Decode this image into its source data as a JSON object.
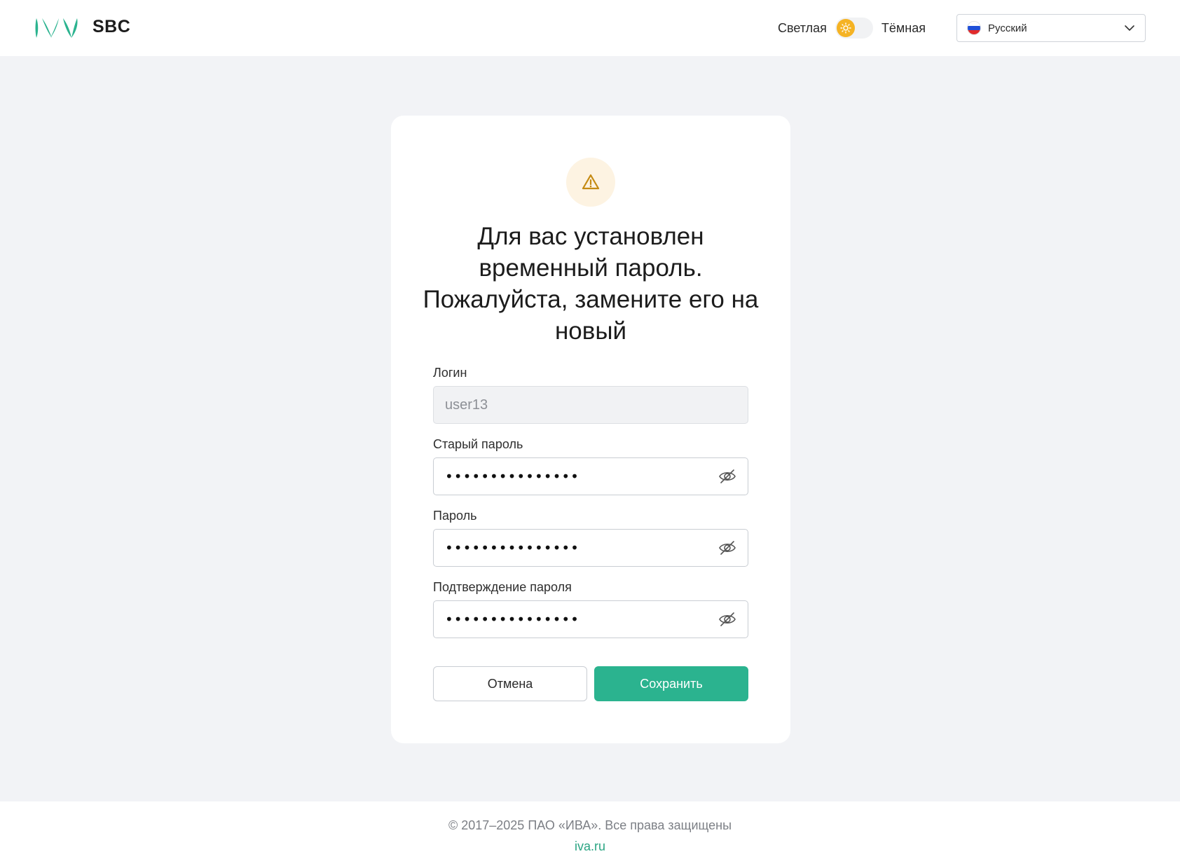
{
  "header": {
    "app_name": "SBC",
    "theme": {
      "light_label": "Светлая",
      "dark_label": "Тёмная",
      "current": "light"
    },
    "language": {
      "selected": "Русский",
      "flag": "ru-flag-icon"
    }
  },
  "card": {
    "icon": "warning-icon",
    "title": "Для вас установлен временный пароль. Пожалуйста, замените его на новый",
    "fields": {
      "login": {
        "label": "Логин",
        "value": "user13"
      },
      "old_password": {
        "label": "Старый пароль",
        "value": "•••••••••••••••"
      },
      "password": {
        "label": "Пароль",
        "value": "•••••••••••••••"
      },
      "confirm_password": {
        "label": "Подтверждение пароля",
        "value": "•••••••••••••••"
      }
    },
    "buttons": {
      "cancel": "Отмена",
      "save": "Сохранить"
    }
  },
  "footer": {
    "copyright": "© 2017–2025 ПАО «ИВА». Все права защищены",
    "link": "iva.ru"
  },
  "colors": {
    "accent": "#2bb38f",
    "warning": "#c58b14",
    "toggle_sun": "#f5b324",
    "background": "#f2f3f6"
  }
}
